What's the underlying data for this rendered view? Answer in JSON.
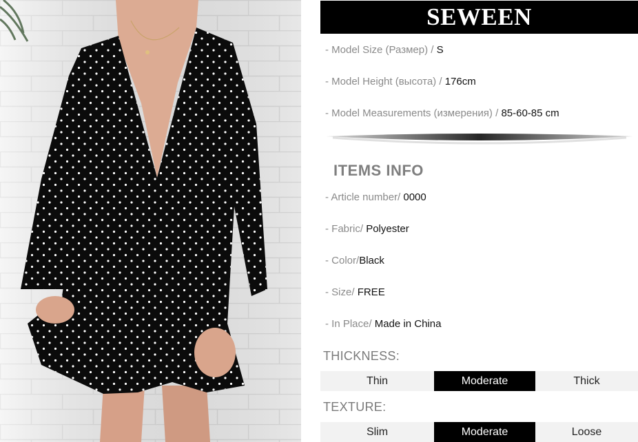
{
  "brand": "SEWEEN",
  "model": [
    {
      "label": "- Model Size (Размер) / ",
      "value": "S"
    },
    {
      "label": "- Model Height (высота) / ",
      "value": "176cm"
    },
    {
      "label": "- Model Measurements (измерения) / ",
      "value": "85-60-85 cm"
    }
  ],
  "items_title": "ITEMS INFO",
  "items": [
    {
      "label": "- Article number/ ",
      "value": "0000"
    },
    {
      "label": "- Fabric/ ",
      "value": "Polyester"
    },
    {
      "label": "- Color/",
      "value": "Black"
    },
    {
      "label": "- Size/ ",
      "value": "FREE"
    },
    {
      "label": "- In Place/ ",
      "value": "Made in China"
    }
  ],
  "thickness": {
    "title": "THICKNESS:",
    "options": [
      "Thin",
      "Moderate",
      "Thick"
    ],
    "selected": "Moderate"
  },
  "texture": {
    "title": "TEXTURE:",
    "options": [
      "Slim",
      "Moderate",
      "Loose"
    ],
    "selected": "Moderate"
  },
  "colors": {
    "dress": "#0b0b0b",
    "wall": "#ececec",
    "skin": "#d9a58c",
    "selected_bg": "#000000",
    "option_bg": "#f2f2f2"
  }
}
